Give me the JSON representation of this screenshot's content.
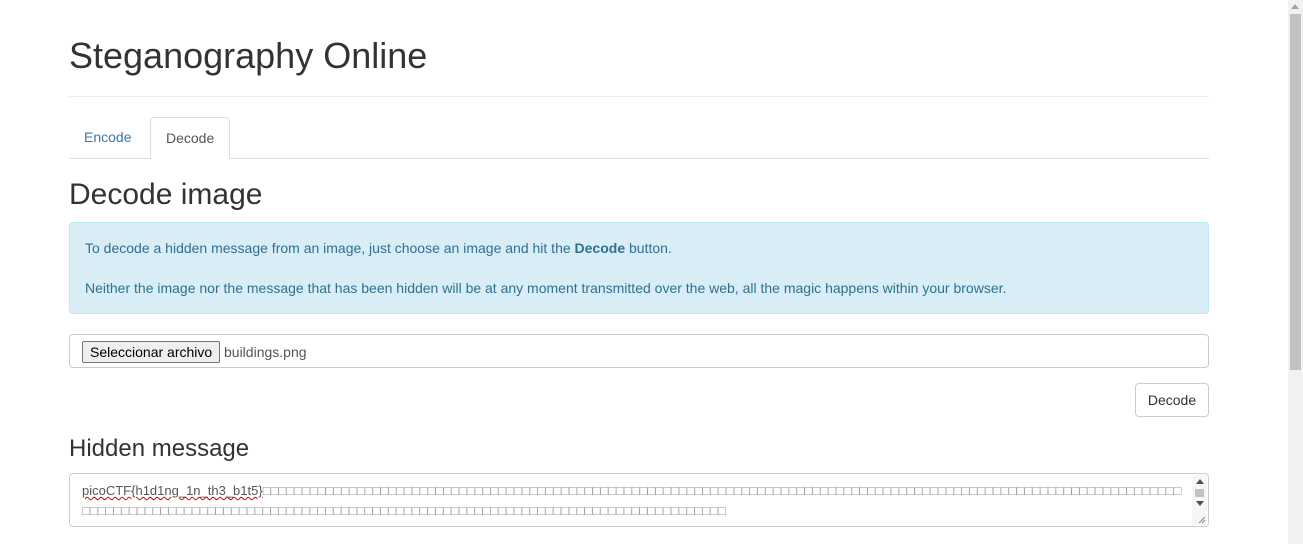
{
  "header": {
    "title": "Steganography Online"
  },
  "tabs": [
    {
      "label": "Encode",
      "active": false
    },
    {
      "label": "Decode",
      "active": true
    }
  ],
  "decode": {
    "title": "Decode image",
    "info_part1": "To decode a hidden message from an image, just choose an image and hit the ",
    "info_bold": "Decode",
    "info_part2": " button.",
    "info_line2": "Neither the image nor the message that has been hidden will be at any moment transmitted over the web, all the magic happens within your browser.",
    "file_button_label": "Seleccionar archivo",
    "file_name": "buildings.png",
    "decode_button": "Decode",
    "hidden_message_title": "Hidden message",
    "hidden_message_flag": "picoCTF{h1d1ng_1n_th3_b1t5}",
    "hidden_message_filler": "□□□□□□□□□□□□□□□□□□□□□□□□□□□□□□□□□□□□□□□□□□□□□□□□□□□□□□□□□□□□□□□□□□□□□□□□□□□□□□□□□□□□□□□□□□□□□□□□□□□□□□□□□□□□□□□□□□□□□□□□□□□□□□□□□□□□□□□□□□□□□□□□□□□□□□□□□□□□□□□□□□□□□□□□□□□□□□□□□□□□□□□□□□□□□□□□□□□□□□□"
  },
  "colors": {
    "link": "#337ab7",
    "alert_bg": "#d9edf7",
    "alert_text": "#31708f",
    "flag_underline": "#e00000"
  }
}
